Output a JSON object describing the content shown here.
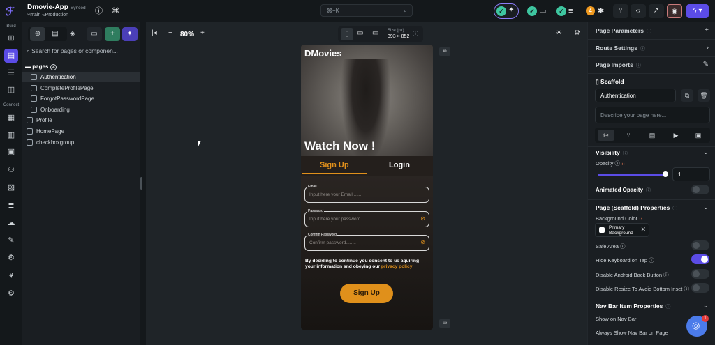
{
  "app": {
    "name": "Dmovie-App",
    "sync_status": "Synced",
    "branch": "main",
    "environment": "Production"
  },
  "topbar": {
    "search_shortcut": "⌘+K",
    "notification_count": "4"
  },
  "rail": {
    "build_label": "Build",
    "connect_label": "Connect"
  },
  "tree": {
    "search_placeholder": "Search for pages or componen...",
    "pages_label": "pages",
    "pages_count": "4",
    "items": [
      "Authentication",
      "CompleteProfilePage",
      "ForgotPasswordPage",
      "Onboarding",
      "Profile",
      "HomePage",
      "checkboxgroup"
    ]
  },
  "canvas": {
    "zoom": "80%",
    "size_label": "Size (px)",
    "size_value": "393 × 852"
  },
  "phone": {
    "app_title": "DMovies",
    "hero_text": "Watch Now !",
    "tab_signup": "Sign Up",
    "tab_login": "Login",
    "email_label": "Email",
    "email_placeholder": "Input here your Email.......",
    "password_label": "Password",
    "password_placeholder": "Input here your password........",
    "confirm_label": "Confirm Password",
    "confirm_placeholder": "Confirm password........",
    "consent_text": "By deciding to continue you consent to us aquiring your information and obeying our",
    "privacy_link": "privacy policy",
    "signup_button": "Sign Up"
  },
  "panel": {
    "page_parameters": "Page Parameters",
    "route_settings": "Route Settings",
    "page_imports": "Page Imports",
    "scaffold": "Scaffold",
    "page_name": "Authentication",
    "description_placeholder": "Describe your page here...",
    "visibility": "Visibility",
    "opacity_label": "Opacity",
    "opacity_value": "1",
    "opacity_level": 1,
    "animated_opacity": "Animated Opacity",
    "scaffold_properties": "Page (Scaffold) Properties",
    "background_color": "Background Color",
    "bg_color_line1": "Primary",
    "bg_color_line2": "Background",
    "safe_area": "Safe Area",
    "hide_keyboard": "Hide Keyboard on Tap",
    "disable_back": "Disable Android Back Button",
    "disable_resize": "Disable Resize To Avoid Bottom Inset",
    "nav_bar_props": "Nav Bar Item Properties",
    "show_nav": "Show on Nav Bar",
    "always_show_nav": "Always Show Nav Bar on Page"
  },
  "chat": {
    "unread": "1"
  },
  "colors": {
    "accent": "#5b4ce6",
    "brand_orange": "#e0901b",
    "success": "#3ec6a0"
  }
}
